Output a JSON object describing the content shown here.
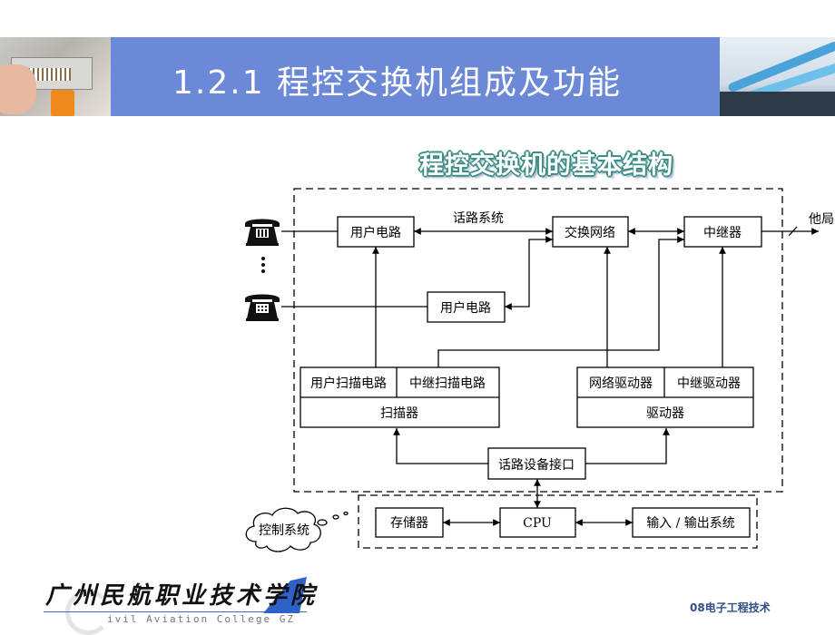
{
  "header": {
    "title": "1.2.1 程控交换机组成及功能",
    "left_image": "photo-punchdown-tool",
    "right_image": "photo-cable-tray"
  },
  "diagram": {
    "title": "程控交换机的基本结构",
    "labels": {
      "speech_system": "话路系统",
      "other_office": "他局",
      "ellipsis": "⋮"
    },
    "blocks": {
      "user_circuit_1": "用户电路",
      "user_circuit_2": "用户电路",
      "switch_network": "交换网络",
      "trunk": "中继器",
      "user_scan_circuit": "用户扫描电路",
      "trunk_scan_circuit": "中继扫描电路",
      "scanner": "扫描器",
      "network_driver": "网络驱动器",
      "trunk_driver": "中继驱动器",
      "driver": "驱动器",
      "speech_device_interface": "话路设备接口",
      "memory": "存储器",
      "cpu": "CPU",
      "io_system": "输入 / 输出系统",
      "control_system": "控制系统"
    },
    "icons": [
      "telephone-icon",
      "telephone-icon"
    ]
  },
  "footer": {
    "school_name": "广州民航职业技术学院",
    "school_name_en": "ivil Aviation College GZ",
    "course": "08电子工程技术"
  },
  "colors": {
    "header_blue": "#6b89d6",
    "subtitle_outline": "#3e8f86",
    "course_text": "#2f4f86"
  }
}
